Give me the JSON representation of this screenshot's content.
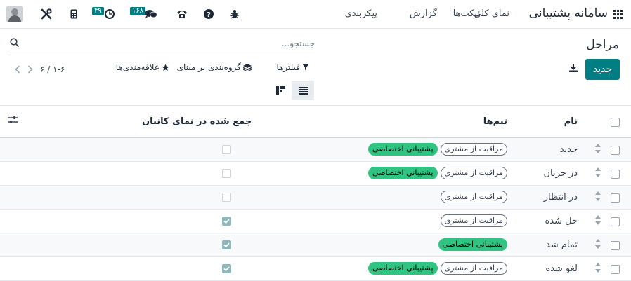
{
  "app": {
    "name": "سامانه پشتیبانی"
  },
  "menu": {
    "items": [
      "نمای کلی",
      "تیکت‌ها",
      "گزارش",
      "پیکربندی"
    ]
  },
  "systray": {
    "activity_count": "۴۹",
    "messages_count": "۱۶۸"
  },
  "page": {
    "title": "مراحل",
    "new_label": "جدید"
  },
  "search": {
    "placeholder": "جستجو..."
  },
  "filters": {
    "filter_label": "فیلترها",
    "groupby_label": "گروه‌بندی بر مبنای",
    "favorites_label": "علاقه‌مندی‌ها"
  },
  "pager": {
    "value": "۱-۶ / ۶"
  },
  "table": {
    "headers": {
      "name": "نام",
      "teams": "تیم‌ها",
      "fold": "جمع شده در نمای کانبان"
    },
    "rows": [
      {
        "name": "جدید",
        "tags": [
          "مراقبت از مشتری",
          "پشتیبانی اختصاصی"
        ],
        "folded": false
      },
      {
        "name": "در جریان",
        "tags": [
          "مراقبت از مشتری",
          "پشتیبانی اختصاصی"
        ],
        "folded": false
      },
      {
        "name": "در انتظار",
        "tags": [
          "مراقبت از مشتری"
        ],
        "folded": false
      },
      {
        "name": "حل شده",
        "tags": [
          "مراقبت از مشتری"
        ],
        "folded": true
      },
      {
        "name": "تمام شد",
        "tags": [
          "پشتیبانی اختصاصی"
        ],
        "folded": true
      },
      {
        "name": "لغو شده",
        "tags": [
          "مراقبت از مشتری",
          "پشتیبانی اختصاصی"
        ],
        "folded": true
      }
    ]
  },
  "colors": {
    "primary": "#017e84",
    "tag_green": "#30c381"
  }
}
